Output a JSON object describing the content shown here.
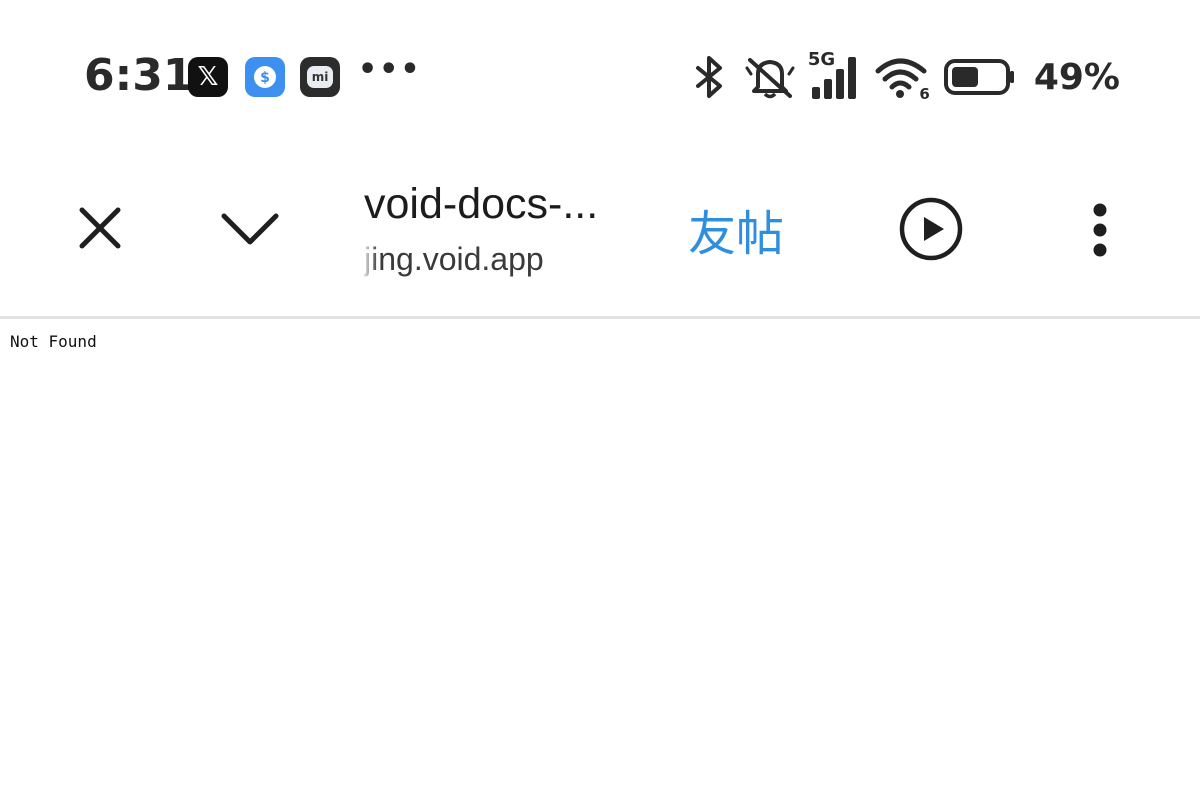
{
  "status_bar": {
    "time": "6:31",
    "notification_icons": [
      "x-app-icon",
      "payment-app-icon",
      "mi-app-icon"
    ],
    "overflow": "•••",
    "network": "5G",
    "wifi_badge": "6",
    "battery_percent": "49%",
    "battery_level": 0.49
  },
  "toolbar": {
    "title": "void-docs-...",
    "url": "jing.void.app",
    "brand_label": "友帖",
    "brand_color": "#2f8fdf"
  },
  "page": {
    "body_text": "Not Found"
  }
}
